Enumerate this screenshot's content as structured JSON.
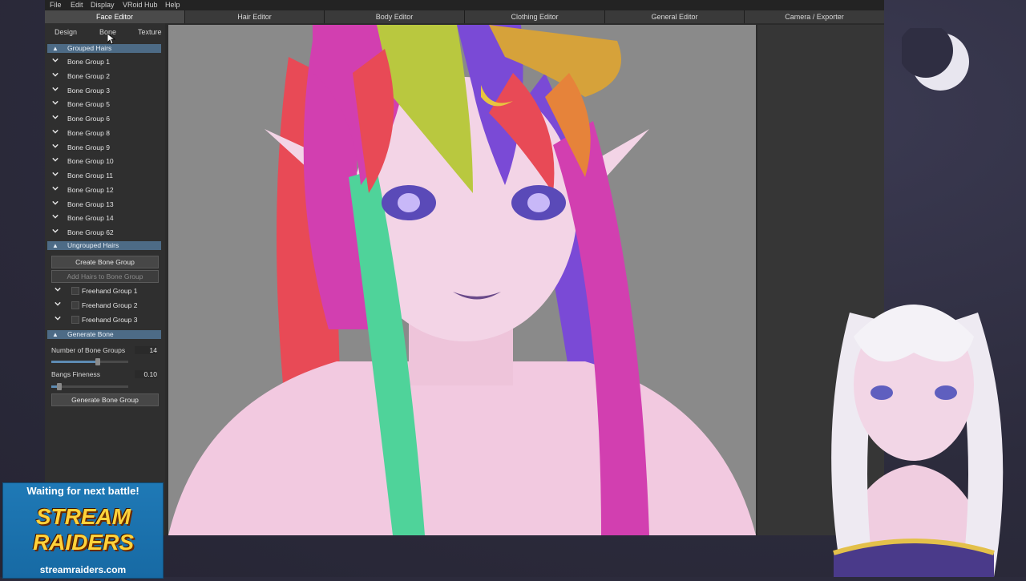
{
  "menu": {
    "items": [
      "File",
      "Edit",
      "Display",
      "VRoid Hub",
      "Help"
    ]
  },
  "editor_tabs": [
    {
      "label": "Face Editor",
      "active": true
    },
    {
      "label": "Hair Editor",
      "active": false
    },
    {
      "label": "Body Editor",
      "active": false
    },
    {
      "label": "Clothing Editor",
      "active": false
    },
    {
      "label": "General Editor",
      "active": false
    },
    {
      "label": "Camera / Exporter",
      "active": false
    }
  ],
  "subtabs": [
    "Design",
    "Bone",
    "Texture"
  ],
  "grouped": {
    "title": "Grouped Hairs",
    "items": [
      "Bone Group 1",
      "Bone Group 2",
      "Bone Group 3",
      "Bone Group 5",
      "Bone Group 6",
      "Bone Group 8",
      "Bone Group 9",
      "Bone Group 10",
      "Bone Group 11",
      "Bone Group 12",
      "Bone Group 13",
      "Bone Group 14",
      "Bone Group 62"
    ]
  },
  "ungrouped": {
    "title": "Ungrouped Hairs",
    "create_btn": "Create Bone Group",
    "add_btn": "Add Hairs to Bone Group",
    "items": [
      "Freehand Group 1",
      "Freehand Group 2",
      "Freehand Group 3"
    ]
  },
  "generate": {
    "title": "Generate Bone",
    "num_label": "Number of Bone Groups",
    "num_value": "14",
    "num_fraction": 0.6,
    "fineness_label": "Bangs Fineness",
    "fineness_value": "0.10",
    "fineness_fraction": 0.1,
    "gen_btn": "Generate Bone Group"
  },
  "overlay": {
    "waiting": "Waiting for next battle!",
    "logo_line1": "STREAM",
    "logo_line2": "RAIDERS",
    "site": "streamraiders.com"
  },
  "colors": {
    "accent": "#4d6b86",
    "hair": [
      "#d23fb0",
      "#e84a56",
      "#b9c83f",
      "#7a4ad6",
      "#d6a23a",
      "#4fd39a",
      "#b04ad8"
    ],
    "skin": "#f3d4e6"
  }
}
